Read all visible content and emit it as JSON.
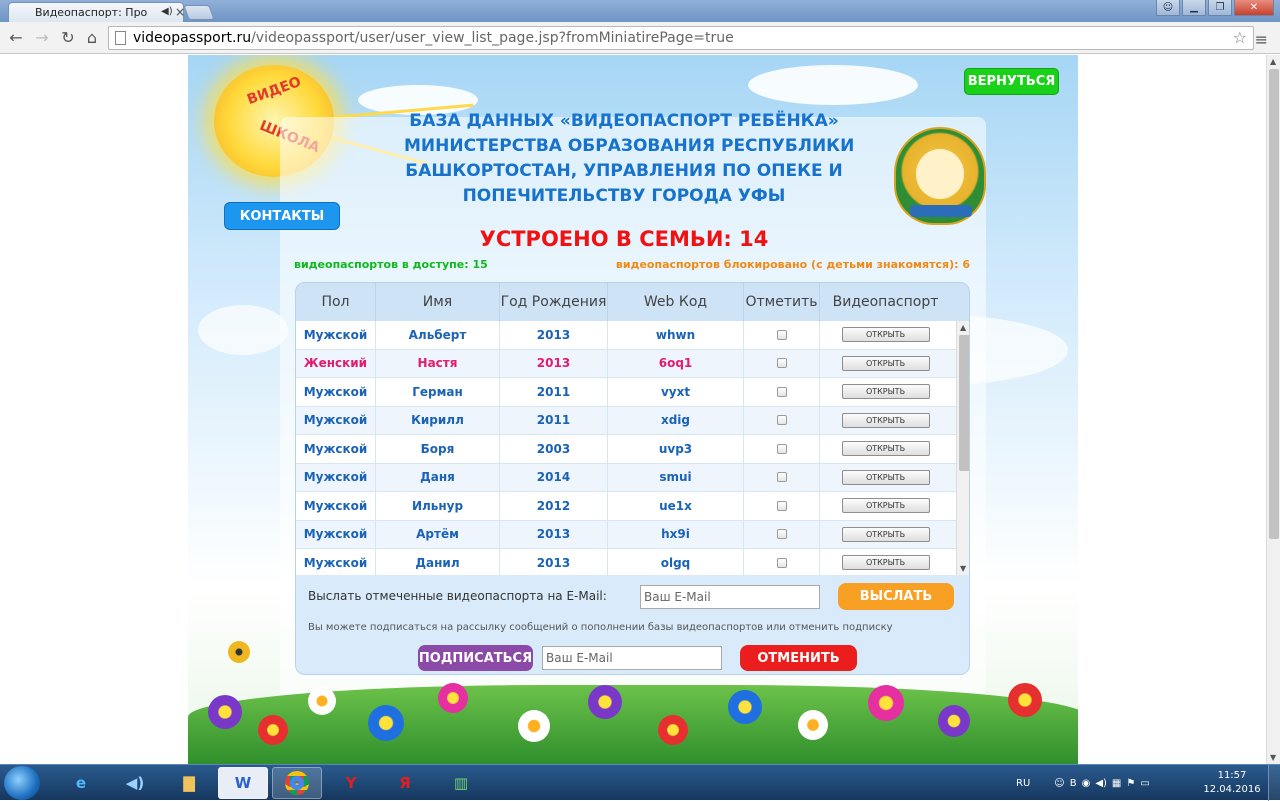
{
  "browser": {
    "tab_title": "Видеопаспорт: Просм",
    "url_domain": "videopassport.ru",
    "url_path": "/videopassport/user/user_view_list_page.jsp?fromMiniatirePage=true"
  },
  "logo": {
    "top": "ВИДЕО",
    "bottom": "ШКОЛА"
  },
  "header": {
    "back_label": "ВЕРНУТЬСЯ",
    "contacts_label": "КОНТАКТЫ",
    "title_lines": [
      "БАЗА ДАННЫХ «ВИДЕОПАСПОРТ РЕБЁНКА»",
      "МИНИСТЕРСТВА ОБРАЗОВАНИЯ РЕСПУБЛИКИ",
      "БАШКОРТОСТАН, УПРАВЛЕНИЯ ПО ОПЕКЕ И",
      "ПОПЕЧИТЕЛЬСТВУ ГОРОДА УФЫ"
    ],
    "placed_label": "УСТРОЕНО В СЕМЬИ: 14",
    "available_label": "видеопаспортов в доступе: 15",
    "blocked_label": "видеопаспортов блокировано (с детьми знакомятся): 6"
  },
  "table": {
    "columns": [
      "Пол",
      "Имя",
      "Год Рождения",
      "Web Код",
      "Отметить",
      "Видеопаспорт"
    ],
    "open_label": "ОТКРЫТЬ",
    "rows": [
      {
        "gender": "Мужской",
        "name": "Альберт",
        "year": "2013",
        "code": "whwn",
        "female": false
      },
      {
        "gender": "Женский",
        "name": "Настя",
        "year": "2013",
        "code": "6oq1",
        "female": true
      },
      {
        "gender": "Мужской",
        "name": "Герман",
        "year": "2011",
        "code": "vyxt",
        "female": false
      },
      {
        "gender": "Мужской",
        "name": "Кирилл",
        "year": "2011",
        "code": "xdig",
        "female": false
      },
      {
        "gender": "Мужской",
        "name": "Боря",
        "year": "2003",
        "code": "uvp3",
        "female": false
      },
      {
        "gender": "Мужской",
        "name": "Даня",
        "year": "2014",
        "code": "smui",
        "female": false
      },
      {
        "gender": "Мужской",
        "name": "Ильнур",
        "year": "2012",
        "code": "ue1x",
        "female": false
      },
      {
        "gender": "Мужской",
        "name": "Артём",
        "year": "2013",
        "code": "hx9i",
        "female": false
      },
      {
        "gender": "Мужской",
        "name": "Данил",
        "year": "2013",
        "code": "olgq",
        "female": false
      }
    ]
  },
  "send": {
    "label": "Выслать отмеченные видеопаспорта на E-Mail:",
    "placeholder": "Ваш E-Mail",
    "button": "ВЫСЛАТЬ"
  },
  "subscribe": {
    "note": "Вы можете подписаться на рассылку сообщений о пополнении базы видеопаспортов или отменить подписку",
    "button": "ПОДПИСАТЬСЯ",
    "placeholder": "Ваш E-Mail",
    "cancel": "ОТМЕНИТЬ"
  },
  "taskbar": {
    "lang": "RU",
    "time": "11:57",
    "date": "12.04.2016"
  }
}
